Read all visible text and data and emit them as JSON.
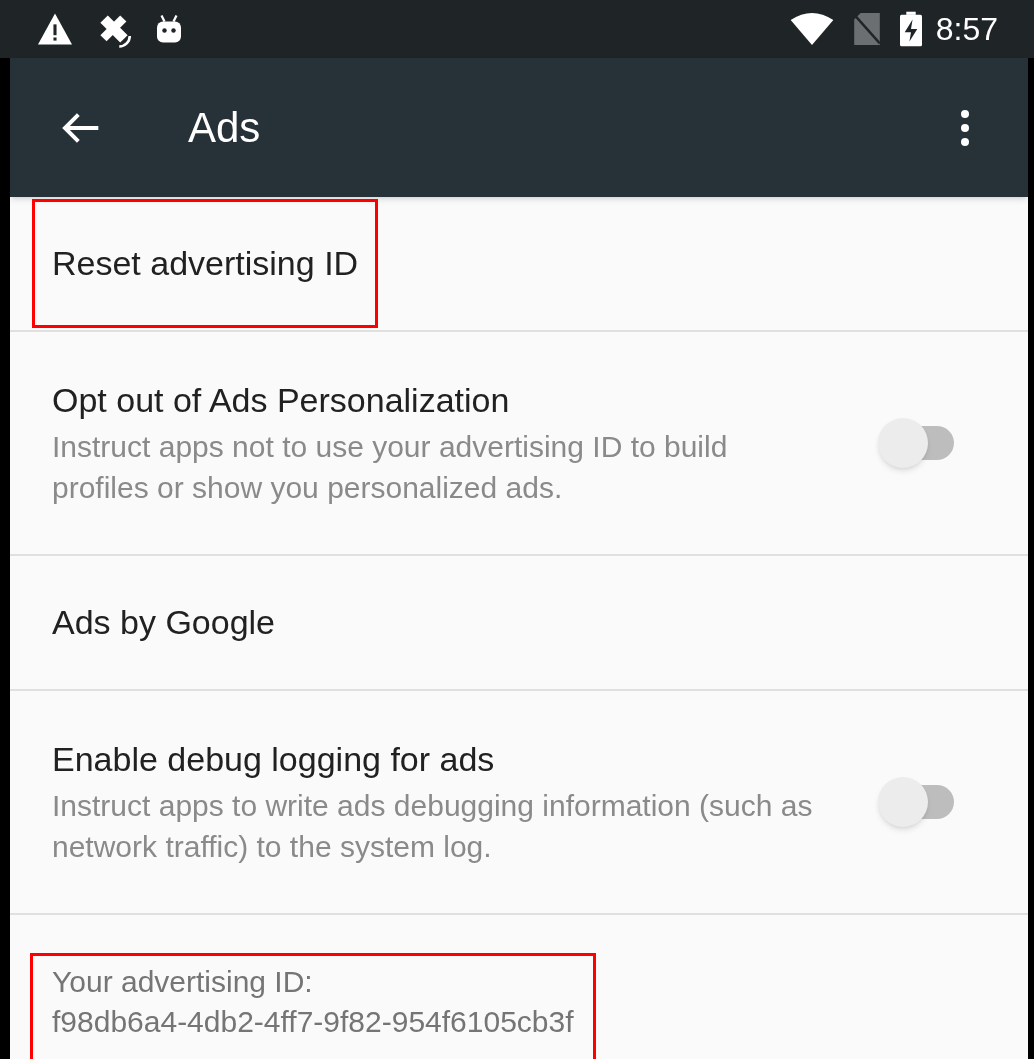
{
  "status_bar": {
    "time": "8:57"
  },
  "app_bar": {
    "title": "Ads"
  },
  "items": [
    {
      "kind": "action",
      "title": "Reset advertising ID",
      "highlighted": true
    },
    {
      "kind": "switch",
      "title": "Opt out of Ads Personalization",
      "summary": "Instruct apps not to use your advertising ID to build profiles or show you personalized ads.",
      "on": false,
      "highlighted": false
    },
    {
      "kind": "action",
      "title": "Ads by Google",
      "highlighted": false
    },
    {
      "kind": "switch",
      "title": "Enable debug logging for ads",
      "summary": "Instruct apps to write ads debugging information (such as network traffic) to the system log.",
      "on": false,
      "highlighted": false
    },
    {
      "kind": "info",
      "lines": [
        "Your advertising ID:",
        "f98db6a4-4db2-4ff7-9f82-954f6105cb3f"
      ],
      "highlighted": true
    }
  ]
}
